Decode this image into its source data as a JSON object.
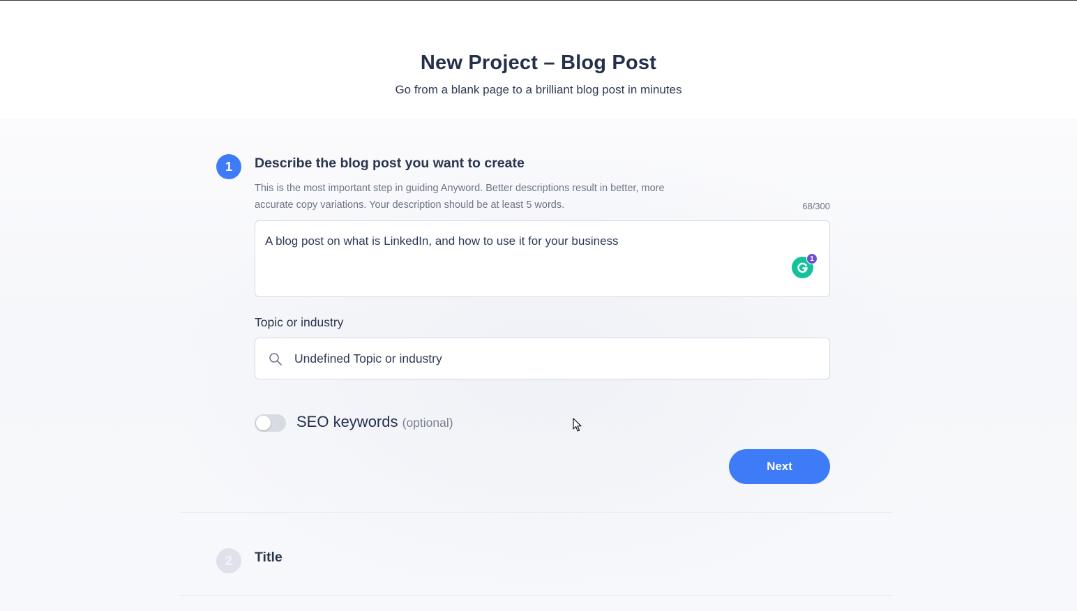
{
  "header": {
    "title": "New Project – Blog Post",
    "subtitle": "Go from a blank page to a brilliant blog post in minutes"
  },
  "step1": {
    "number": "1",
    "heading": "Describe the blog post you want to create",
    "description": "This is the most important step in guiding Anyword. Better descriptions result in better, more accurate copy variations. Your description should be at least 5 words.",
    "char_count": "68/300",
    "input_value": "A blog post on what is LinkedIn, and how to use it for your business",
    "grammarly_badge_count": "1"
  },
  "topic": {
    "label": "Topic or industry",
    "value": "Undefined Topic or industry"
  },
  "seo": {
    "label": "SEO keywords",
    "optional": "(optional)",
    "enabled": false
  },
  "actions": {
    "next_label": "Next"
  },
  "step2": {
    "number": "2",
    "heading": "Title"
  },
  "colors": {
    "accent": "#3d7bf7",
    "grammarly": "#15c39a",
    "grammarly_badge": "#6f4ed8"
  }
}
